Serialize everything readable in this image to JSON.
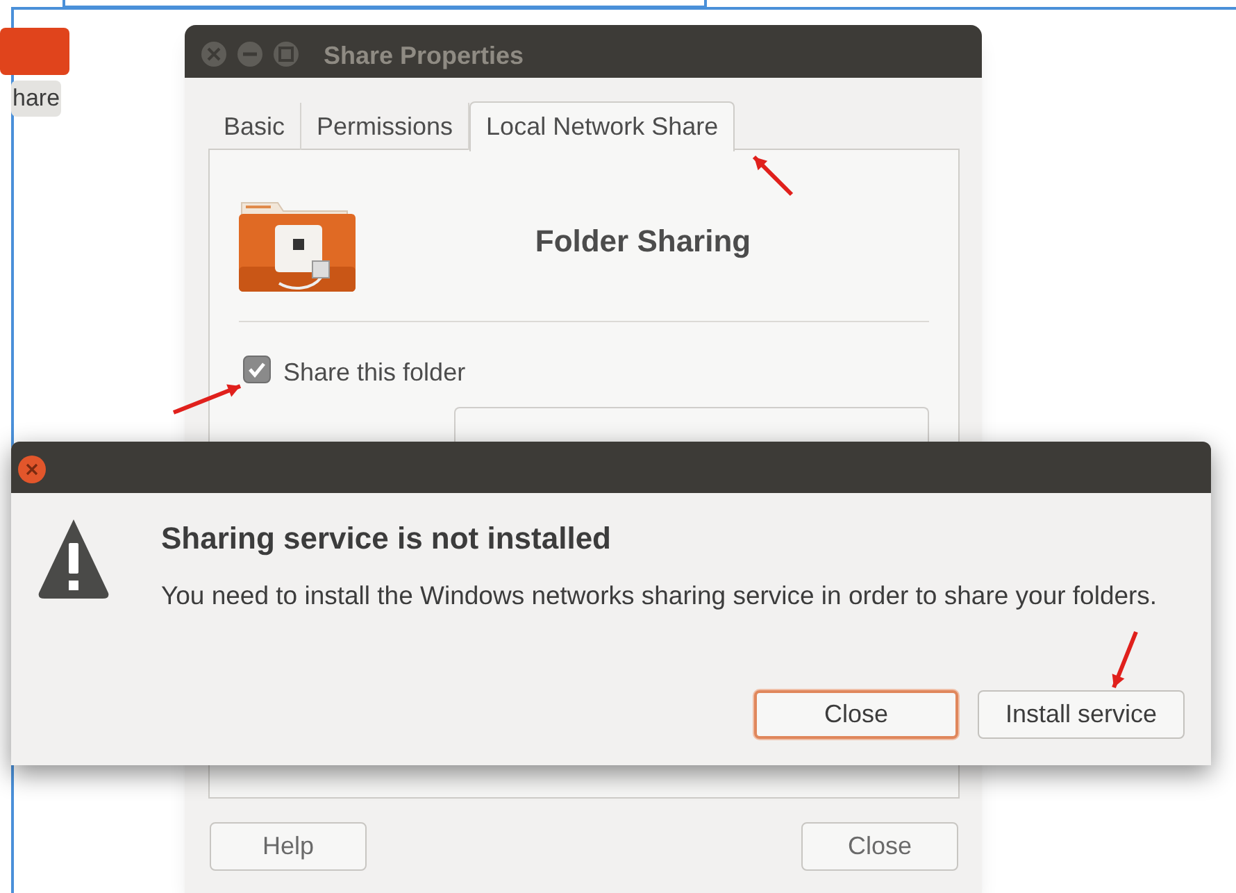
{
  "desktop": {
    "icon_label": "hare"
  },
  "properties_window": {
    "title": "Share Properties",
    "tabs": [
      {
        "label": "Basic",
        "selected": false
      },
      {
        "label": "Permissions",
        "selected": false
      },
      {
        "label": "Local Network Share",
        "selected": true
      }
    ],
    "heading": "Folder Sharing",
    "share_checkbox": {
      "label": "Share this folder",
      "checked": true
    },
    "buttons": [
      {
        "label": "Help"
      },
      {
        "label": "Close"
      }
    ]
  },
  "dialog": {
    "heading": "Sharing service is not installed",
    "message": "You need to install the Windows networks sharing service in order to share your folders.",
    "buttons": [
      {
        "label": "Close",
        "focused": true
      },
      {
        "label": "Install service",
        "focused": false
      }
    ]
  }
}
